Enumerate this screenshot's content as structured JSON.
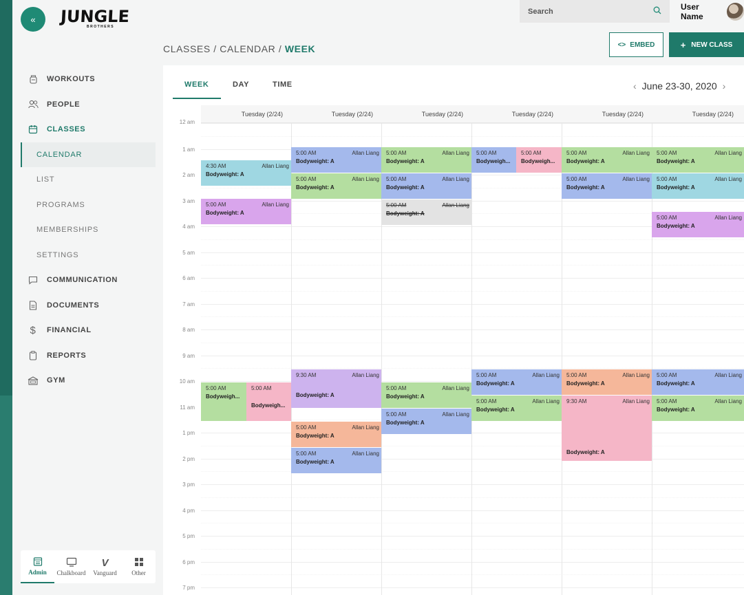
{
  "brand": {
    "logo_main": "JUNGLE",
    "logo_sub": "BROTHERS"
  },
  "header": {
    "search_placeholder": "Search",
    "user_name": "User Name"
  },
  "breadcrumb": {
    "part1": "CLASSES",
    "sep": "/",
    "part2": "CALENDAR",
    "current": "WEEK"
  },
  "actions": {
    "embed_label": "EMBED",
    "new_class_label": "NEW CLASS"
  },
  "sidebar": {
    "items": [
      {
        "label": "WORKOUTS",
        "icon": "kettlebell-icon"
      },
      {
        "label": "PEOPLE",
        "icon": "people-icon"
      },
      {
        "label": "CLASSES",
        "icon": "calendar-icon",
        "active": true
      }
    ],
    "sub_items": [
      {
        "label": "CALENDAR",
        "active": true
      },
      {
        "label": "LIST"
      },
      {
        "label": "PROGRAMS"
      },
      {
        "label": "MEMBERSHIPS"
      },
      {
        "label": "SETTINGS"
      }
    ],
    "items2": [
      {
        "label": "COMMUNICATION",
        "icon": "chat-icon"
      },
      {
        "label": "DOCUMENTS",
        "icon": "document-icon"
      },
      {
        "label": "FINANCIAL",
        "icon": "dollar-icon"
      },
      {
        "label": "REPORTS",
        "icon": "clipboard-icon"
      },
      {
        "label": "GYM",
        "icon": "gym-icon"
      }
    ]
  },
  "app_switcher": [
    {
      "label": "Admin",
      "icon": "admin-icon",
      "active": true
    },
    {
      "label": "Chalkboard",
      "icon": "monitor-icon"
    },
    {
      "label": "Vanguard",
      "icon": "vanguard-icon"
    },
    {
      "label": "Other",
      "icon": "grid-icon"
    }
  ],
  "calendar": {
    "view_tabs": [
      "WEEK",
      "DAY",
      "TIME"
    ],
    "active_view": "WEEK",
    "date_range": "June 23-30, 2020",
    "days": [
      "Tuesday (2/24)",
      "Tuesday (2/24)",
      "Tuesday (2/24)",
      "Tuesday (2/24)",
      "Tuesday (2/24)",
      "Tuesday (2/24)"
    ],
    "hours": [
      "12 am",
      "1 am",
      "2 am",
      "3 am",
      "4 am",
      "5 am",
      "6 am",
      "7 am",
      "8 am",
      "9 am",
      "10 am",
      "11 am",
      "1 pm",
      "2 pm",
      "3 pm",
      "4 pm",
      "5 pm",
      "6 pm",
      "7 pm"
    ],
    "colors": {
      "blue": "#a4b9ec",
      "green": "#b4dea0",
      "cyan": "#9fd7e2",
      "purple": "#d9a5ec",
      "lavender": "#cdb3ee",
      "pink": "#f5b6c7",
      "orange": "#f5b79a",
      "gray": "#e3e3e3",
      "accent": "#1f7a6a"
    },
    "events": [
      {
        "day": 0,
        "time": "4:30 AM",
        "coach": "Allan Liang",
        "name": "Bodyweight: A",
        "color": "cyan"
      },
      {
        "day": 0,
        "time": "5:00 AM",
        "coach": "Allan Liang",
        "name": "Bodyweight: A",
        "color": "purple"
      },
      {
        "day": 0,
        "time": "5:00 AM",
        "coach": "",
        "name": "Bodyweigh...",
        "color": "green"
      },
      {
        "day": 0,
        "time": "5:00 AM",
        "coach": "",
        "name": "Bodyweigh...",
        "color": "pink"
      },
      {
        "day": 1,
        "time": "5:00 AM",
        "coach": "Allan Liang",
        "name": "Bodyweight: A",
        "color": "blue"
      },
      {
        "day": 1,
        "time": "5:00 AM",
        "coach": "Allan Liang",
        "name": "Bodyweight: A",
        "color": "green"
      },
      {
        "day": 1,
        "time": "9:30 AM",
        "coach": "Allan Liang",
        "name": "Bodyweight: A",
        "color": "lavender"
      },
      {
        "day": 1,
        "time": "5:00 AM",
        "coach": "Allan Liang",
        "name": "Bodyweight: A",
        "color": "orange"
      },
      {
        "day": 1,
        "time": "5:00 AM",
        "coach": "Allan Liang",
        "name": "Bodyweight: A",
        "color": "blue"
      },
      {
        "day": 2,
        "time": "5:00 AM",
        "coach": "Allan Liang",
        "name": "Bodyweight: A",
        "color": "green"
      },
      {
        "day": 2,
        "time": "5:00 AM",
        "coach": "Allan Liang",
        "name": "Bodyweight: A",
        "color": "blue"
      },
      {
        "day": 2,
        "time": "5:00 AM",
        "coach": "Allan Liang",
        "name": "Bodyweight: A",
        "color": "gray",
        "cancelled": true
      },
      {
        "day": 2,
        "time": "5:00 AM",
        "coach": "Allan Liang",
        "name": "Bodyweight: A",
        "color": "green"
      },
      {
        "day": 2,
        "time": "5:00 AM",
        "coach": "Allan Liang",
        "name": "Bodyweight: A",
        "color": "blue"
      },
      {
        "day": 3,
        "time": "5:00 AM",
        "coach": "",
        "name": "Bodyweigh...",
        "color": "blue"
      },
      {
        "day": 3,
        "time": "5:00 AM",
        "coach": "",
        "name": "Bodyweigh...",
        "color": "pink"
      },
      {
        "day": 3,
        "time": "5:00 AM",
        "coach": "Allan Liang",
        "name": "Bodyweight: A",
        "color": "blue"
      },
      {
        "day": 3,
        "time": "5:00 AM",
        "coach": "Allan Liang",
        "name": "Bodyweight: A",
        "color": "green"
      },
      {
        "day": 4,
        "time": "5:00 AM",
        "coach": "Allan Liang",
        "name": "Bodyweight: A",
        "color": "green"
      },
      {
        "day": 4,
        "time": "5:00 AM",
        "coach": "Allan Liang",
        "name": "Bodyweight: A",
        "color": "blue"
      },
      {
        "day": 4,
        "time": "5:00 AM",
        "coach": "Allan Liang",
        "name": "Bodyweight: A",
        "color": "orange"
      },
      {
        "day": 4,
        "time": "9:30 AM",
        "coach": "Allan Liang",
        "name": "Bodyweight: A",
        "color": "pink"
      },
      {
        "day": 5,
        "time": "5:00 AM",
        "coach": "Allan Liang",
        "name": "Bodyweight: A",
        "color": "green"
      },
      {
        "day": 5,
        "time": "5:00 AM",
        "coach": "Allan Liang",
        "name": "Bodyweight: A",
        "color": "cyan"
      },
      {
        "day": 5,
        "time": "5:00 AM",
        "coach": "Allan Liang",
        "name": "Bodyweight: A",
        "color": "purple"
      },
      {
        "day": 5,
        "time": "5:00 AM",
        "coach": "Allan Liang",
        "name": "Bodyweight: A",
        "color": "blue"
      },
      {
        "day": 5,
        "time": "5:00 AM",
        "coach": "Allan Liang",
        "name": "Bodyweight: A",
        "color": "green"
      }
    ]
  }
}
